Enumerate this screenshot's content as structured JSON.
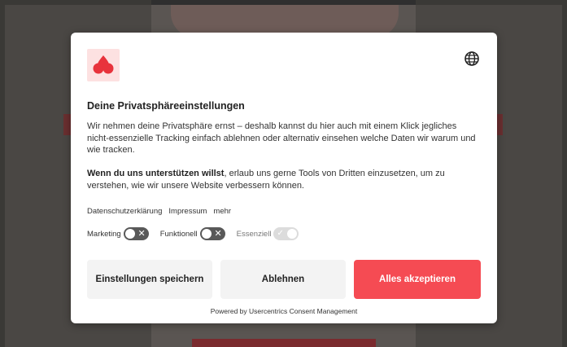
{
  "dialog": {
    "title": "Deine Privatsphäreeinstellungen",
    "intro": "Wir nehmen deine Privatsphäre ernst – deshalb kannst du hier auch mit einem Klick jegliches nicht-essenzielle Tracking einfach ablehnen oder alternativ einsehen welche Daten wir warum und wie tracken.",
    "support_bold": "Wenn du uns unterstützen willst",
    "support_rest": ", erlaub uns gerne Tools von Dritten einzusetzen, um zu verstehen, wie wir unsere Website verbessern können.",
    "links": {
      "privacy": "Datenschutzerklärung",
      "imprint": "Impressum",
      "more": "mehr"
    },
    "toggles": {
      "marketing": {
        "label": "Marketing",
        "state": "off"
      },
      "functional": {
        "label": "Funktionell",
        "state": "off"
      },
      "essential": {
        "label": "Essenziell",
        "state": "on-disabled"
      }
    },
    "buttons": {
      "save": "Einstellungen speichern",
      "deny": "Ablehnen",
      "accept": "Alles akzeptieren"
    },
    "powered_by": "Powered by Usercentrics Consent Management"
  },
  "icons": {
    "logo": "heart-drops-logo-icon",
    "language": "globe-icon"
  },
  "colors": {
    "accent": "#f54b53",
    "logo_bg": "#fde1e1",
    "toggle_off": "#595959",
    "button_bg": "#f3f3f3"
  }
}
